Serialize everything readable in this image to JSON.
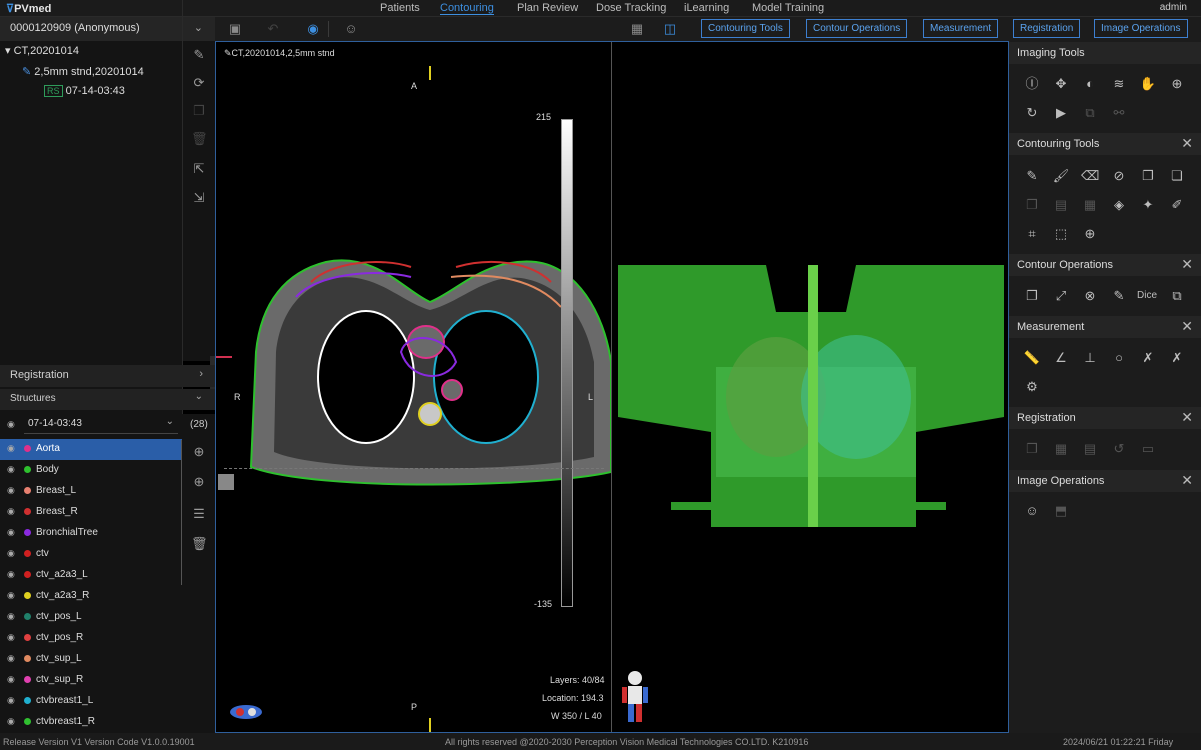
{
  "app": {
    "logo": "PVmed",
    "user": "admin"
  },
  "nav": [
    "Patients",
    "Contouring",
    "Plan Review",
    "Dose Tracking",
    "iLearning",
    "Model Training"
  ],
  "patient": {
    "id": "0000120909 (Anonymous)",
    "study": "CT,20201014",
    "series": "2,5mm stnd,20201014",
    "rs_badge": "RS",
    "rs_time": "07-14-03:43"
  },
  "registration_label": "Registration",
  "structures": {
    "label": "Structures",
    "selected_set": "07-14-03:43",
    "count": "(28)",
    "items": [
      {
        "name": "Aorta",
        "color": "#e0308a"
      },
      {
        "name": "Body",
        "color": "#2ec02e"
      },
      {
        "name": "Breast_L",
        "color": "#e88070"
      },
      {
        "name": "Breast_R",
        "color": "#d03030"
      },
      {
        "name": "BronchialTree",
        "color": "#8a2ae0"
      },
      {
        "name": "ctv",
        "color": "#d02020"
      },
      {
        "name": "ctv_a2a3_L",
        "color": "#d02020"
      },
      {
        "name": "ctv_a2a3_R",
        "color": "#e0d020"
      },
      {
        "name": "ctv_pos_L",
        "color": "#20806a"
      },
      {
        "name": "ctv_pos_R",
        "color": "#e04040"
      },
      {
        "name": "ctv_sup_L",
        "color": "#e08a60"
      },
      {
        "name": "ctv_sup_R",
        "color": "#e040b0"
      },
      {
        "name": "ctvbreast1_L",
        "color": "#20b0d0"
      },
      {
        "name": "ctvbreast1_R",
        "color": "#30c030"
      }
    ]
  },
  "tabs": [
    "Contouring Tools",
    "Contour Operations",
    "Measurement",
    "Registration",
    "Image Operations"
  ],
  "viewer": {
    "series_label": "CT,20201014,2,5mm stnd",
    "orient_top": "A",
    "orient_bottom": "P",
    "orient_right": "L",
    "orient_left": "R",
    "scale_max": "215",
    "scale_min": "-135",
    "layers": "Layers: 40/84",
    "location": "Location: 194.3",
    "window": "W 350 / L 40"
  },
  "right_panel": {
    "imaging_tools": "Imaging Tools",
    "contouring_tools": "Contouring Tools",
    "contour_operations": "Contour Operations",
    "dice_label": "Dice",
    "measurement": "Measurement",
    "registration": "Registration",
    "image_operations": "Image Operations"
  },
  "status": {
    "version": "Release Version V1 Version Code V1.0.0.19001",
    "copyright": "All rights reserved @2020-2030 Perception Vision Medical Technologies CO.LTD. K210916",
    "datetime": "2024/06/21 01:22:21 Friday"
  }
}
